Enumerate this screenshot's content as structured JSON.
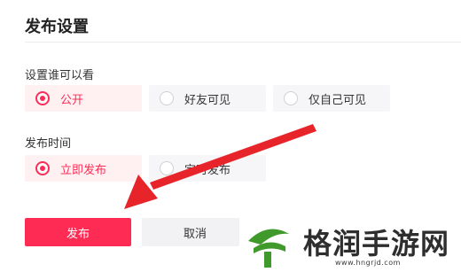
{
  "header": {
    "title": "发布设置"
  },
  "visibility": {
    "label": "设置谁可以看",
    "options": [
      {
        "label": "公开",
        "selected": true
      },
      {
        "label": "好友可见",
        "selected": false
      },
      {
        "label": "仅自己可见",
        "selected": false
      }
    ]
  },
  "publish_time": {
    "label": "发布时间",
    "options": [
      {
        "label": "立即发布",
        "selected": true
      },
      {
        "label": "定时发布",
        "selected": false
      }
    ]
  },
  "actions": {
    "publish_label": "发布",
    "cancel_label": "取消"
  },
  "watermark": {
    "text": "格润手游网",
    "url": "www.hngrjd.com"
  },
  "colors": {
    "accent": "#fe2c55",
    "arrow": "#e8242b",
    "logo_green": "#3f9a2b"
  }
}
